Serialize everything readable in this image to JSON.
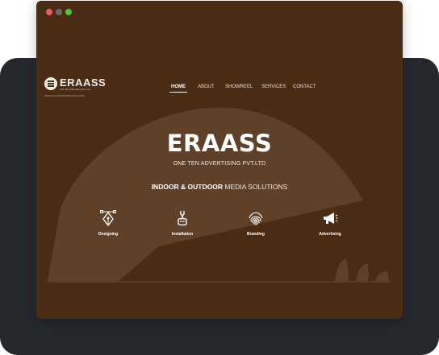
{
  "window": {
    "controls": [
      "close-dot",
      "minimize-dot",
      "maximize-dot"
    ]
  },
  "logo": {
    "name": "ERAASS",
    "subtitle": "One Ten Advertising Pvt. Ltd.",
    "tagline": "INDOOR & OUTDOOR MEDIA SOLUTIONS"
  },
  "nav": {
    "items": [
      {
        "label": "HOME",
        "active": true
      },
      {
        "label": "ABOUT",
        "active": false
      },
      {
        "label": "SHOWREEL",
        "active": false
      },
      {
        "label": "SERVICES",
        "active": false
      },
      {
        "label": "CONTACT",
        "active": false
      }
    ]
  },
  "hero": {
    "title": "ERAASS",
    "subtitle": "ONE TEN ADVERTISING PVT.LTD",
    "tagline_bold": "INDOOR & OUTDOOR",
    "tagline_rest": " MEDIA SOLUTIONS"
  },
  "services": [
    {
      "label": "Designing",
      "icon": "pen-nib-icon"
    },
    {
      "label": "Installation",
      "icon": "wrench-hand-icon"
    },
    {
      "label": "Branding",
      "icon": "fingerprint-icon"
    },
    {
      "label": "Advertising",
      "icon": "megaphone-icon"
    }
  ],
  "colors": {
    "page_background": "#4a2c15",
    "arch": "#5f412a",
    "backdrop_card": "#25282d",
    "text": "#ffffff"
  }
}
